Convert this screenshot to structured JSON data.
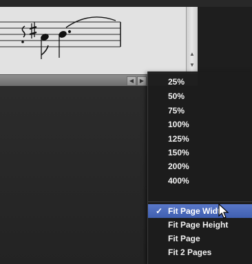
{
  "zoom_menu": {
    "items": [
      {
        "label": "25%",
        "selected": false
      },
      {
        "label": "50%",
        "selected": false
      },
      {
        "label": "75%",
        "selected": false
      },
      {
        "label": "100%",
        "selected": false
      },
      {
        "label": "125%",
        "selected": false
      },
      {
        "label": "150%",
        "selected": false
      },
      {
        "label": "200%",
        "selected": false
      },
      {
        "label": "400%",
        "selected": false
      }
    ],
    "fit_items": [
      {
        "label": "Fit Page Width",
        "selected": true,
        "check": "✓"
      },
      {
        "label": "Fit Page Height",
        "selected": false,
        "check": ""
      },
      {
        "label": "Fit Page",
        "selected": false,
        "check": ""
      },
      {
        "label": "Fit 2 Pages",
        "selected": false,
        "check": ""
      }
    ]
  },
  "colors": {
    "menu_background": "#1c1c1c",
    "menu_text": "#f2f2f2",
    "selection_highlight": "#4a6bc0",
    "score_background": "#e2e2e2"
  },
  "icons": {
    "scroll_up": "triangle-up-icon",
    "scroll_down": "triangle-down-icon",
    "scroll_left": "triangle-left-icon",
    "scroll_right": "triangle-right-icon",
    "cursor": "arrow-cursor-icon"
  }
}
